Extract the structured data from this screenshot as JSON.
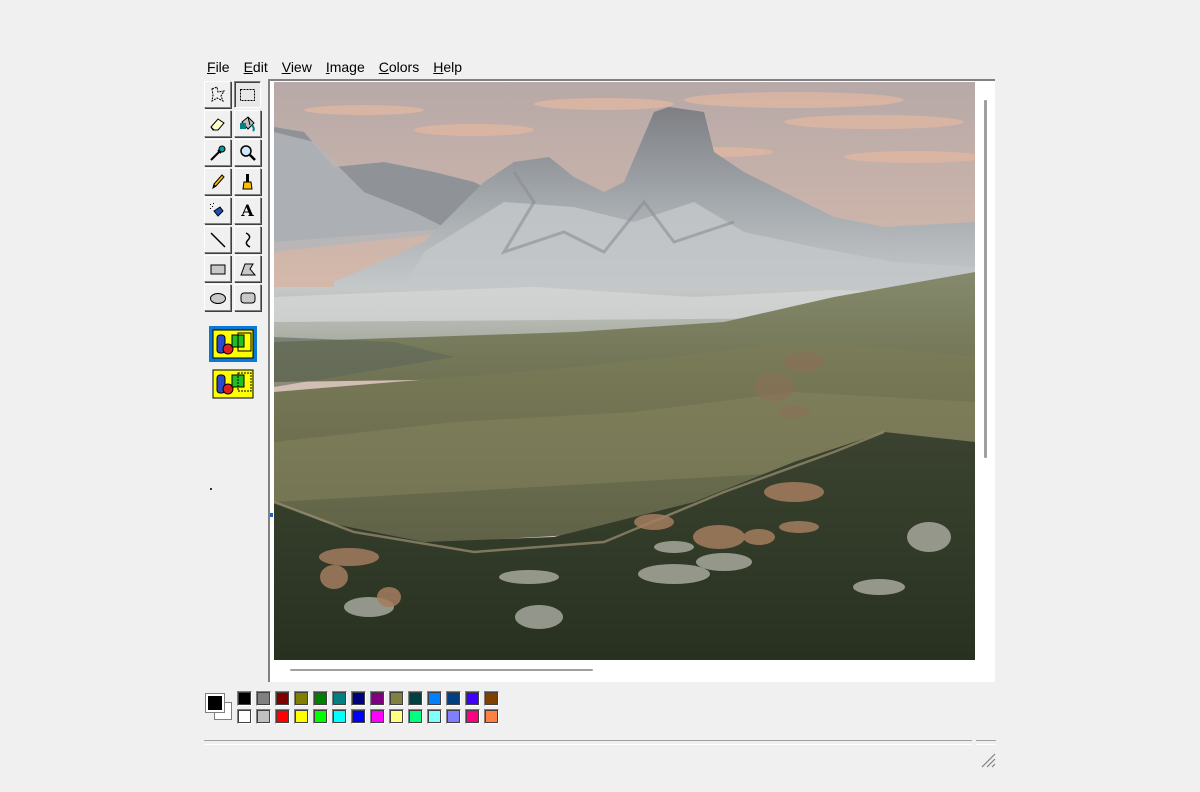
{
  "menu": [
    {
      "label": "File",
      "access": "F",
      "rest": "ile"
    },
    {
      "label": "Edit",
      "access": "E",
      "rest": "dit"
    },
    {
      "label": "View",
      "access": "V",
      "rest": "iew"
    },
    {
      "label": "Image",
      "access": "I",
      "rest": "mage"
    },
    {
      "label": "Colors",
      "access": "C",
      "rest": "olors"
    },
    {
      "label": "Help",
      "access": "H",
      "rest": "elp"
    }
  ],
  "tools": [
    {
      "name": "free-form-select-icon",
      "pressed": false
    },
    {
      "name": "rectangle-select-icon",
      "pressed": true
    },
    {
      "name": "eraser-icon",
      "pressed": false
    },
    {
      "name": "fill-bucket-icon",
      "pressed": false
    },
    {
      "name": "color-picker-icon",
      "pressed": false
    },
    {
      "name": "magnifier-icon",
      "pressed": false
    },
    {
      "name": "pencil-icon",
      "pressed": false
    },
    {
      "name": "brush-icon",
      "pressed": false
    },
    {
      "name": "airbrush-icon",
      "pressed": false
    },
    {
      "name": "text-icon",
      "pressed": false
    },
    {
      "name": "line-icon",
      "pressed": false
    },
    {
      "name": "curve-icon",
      "pressed": false
    },
    {
      "name": "rectangle-icon",
      "pressed": false
    },
    {
      "name": "polygon-icon",
      "pressed": false
    },
    {
      "name": "ellipse-icon",
      "pressed": false
    },
    {
      "name": "rounded-rectangle-icon",
      "pressed": false
    }
  ],
  "text_tool_glyph": "A",
  "selection_options": [
    {
      "name": "opaque-selection-icon",
      "selected": true
    },
    {
      "name": "transparent-selection-icon",
      "selected": false
    }
  ],
  "foreground_color": "#000000",
  "background_color": "#ffffff",
  "palette_top": [
    "#000000",
    "#808080",
    "#800000",
    "#808000",
    "#008000",
    "#008080",
    "#000080",
    "#800080",
    "#808040",
    "#004040",
    "#0080ff",
    "#004080",
    "#4000ff",
    "#804000"
  ],
  "palette_bottom": [
    "#ffffff",
    "#c0c0c0",
    "#ff0000",
    "#ffff00",
    "#00ff00",
    "#00ffff",
    "#0000ff",
    "#ff00ff",
    "#ffff80",
    "#00ff80",
    "#80ffff",
    "#8080ff",
    "#ff0080",
    "#ff8040"
  ],
  "status_text": "",
  "accent_color": "#0a78d7"
}
